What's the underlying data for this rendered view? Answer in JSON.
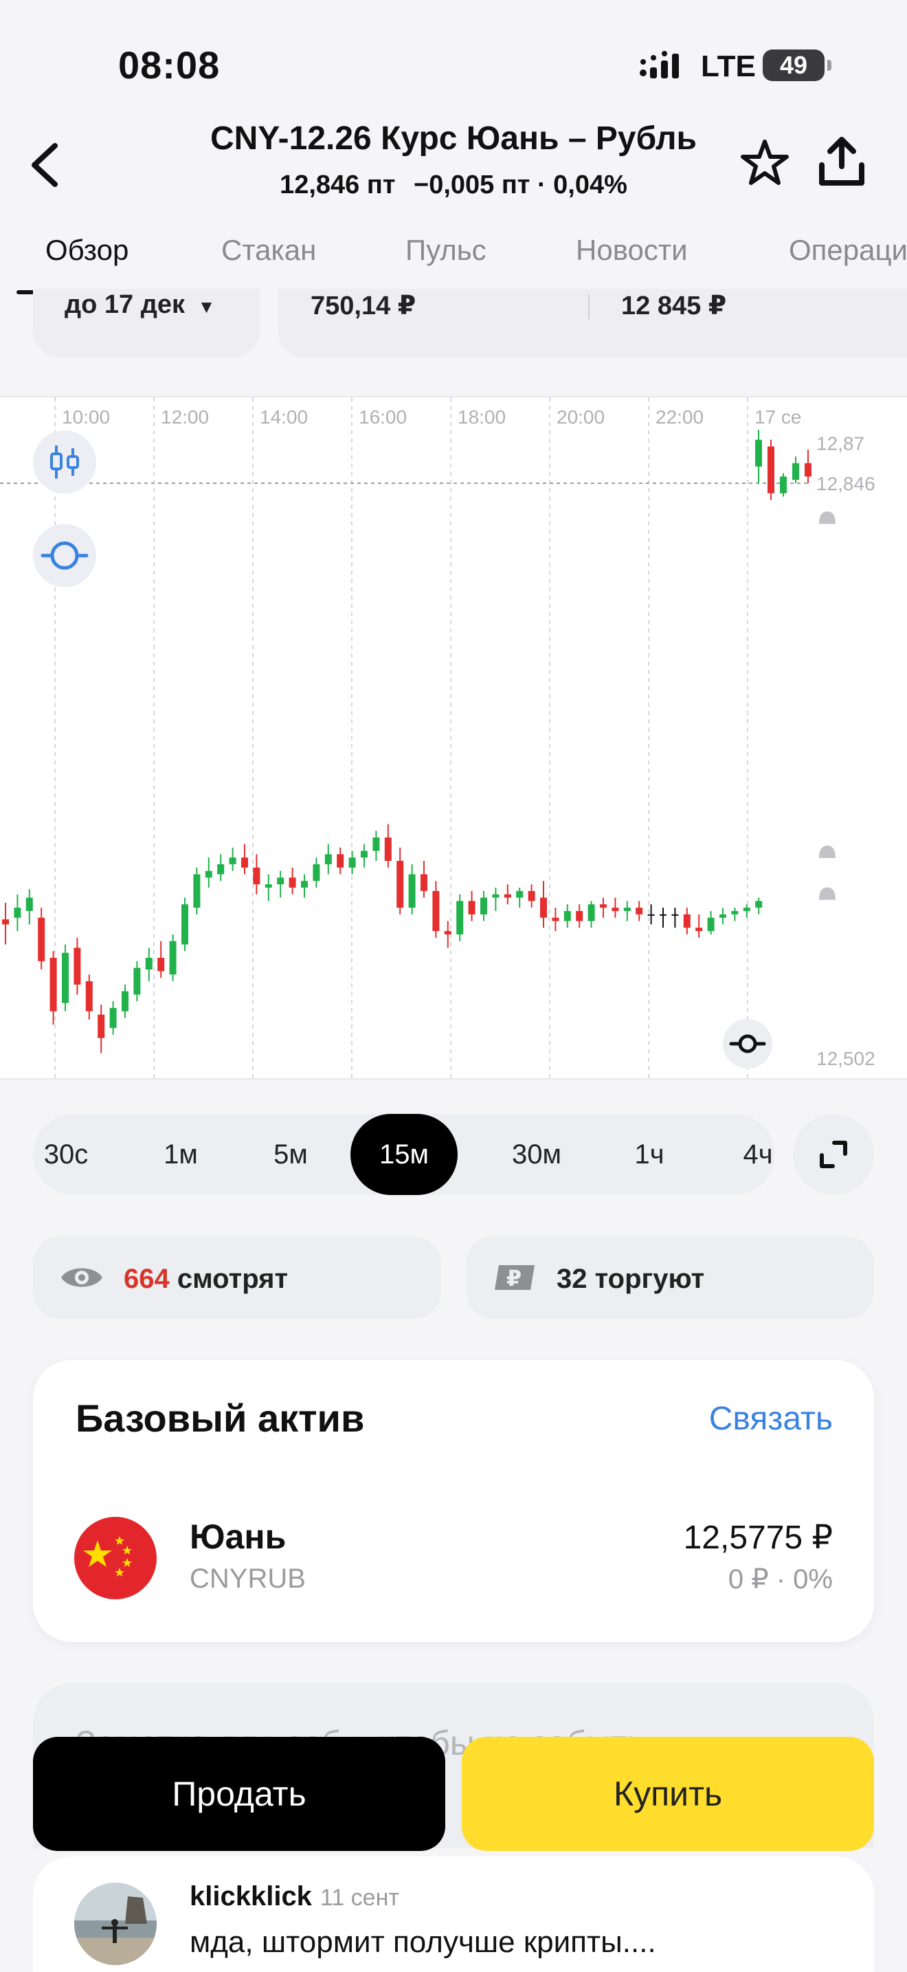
{
  "status_bar": {
    "time": "08:08",
    "network": "LTE",
    "battery": "49"
  },
  "header": {
    "title": "CNY-12.26 Курс Юань – Рубль",
    "price": "12,846 пт",
    "change": "−0,005 пт · 0,04%"
  },
  "tabs": [
    "Обзор",
    "Стакан",
    "Пульс",
    "Новости",
    "Операци"
  ],
  "summary": {
    "expiry": "до 17 дек",
    "value1": "750,14 ₽",
    "value2": "12 845 ₽"
  },
  "chart_data": {
    "type": "candlestick",
    "x_ticks": [
      "10:00",
      "12:00",
      "14:00",
      "16:00",
      "18:00",
      "20:00",
      "22:00",
      "17 се"
    ],
    "y_ticks": [
      "12,87",
      "12,846",
      "12,502"
    ],
    "current_price": "12,846",
    "ylim": [
      12.49,
      12.885
    ],
    "up_color": "#21b24b",
    "down_color": "#e52e2e",
    "series": [
      {
        "name": "",
        "values": [
          {
            "o": 12.585,
            "h": 12.595,
            "l": 12.57,
            "c": 12.582
          },
          {
            "o": 12.586,
            "h": 12.6,
            "l": 12.578,
            "c": 12.592
          },
          {
            "o": 12.59,
            "h": 12.603,
            "l": 12.582,
            "c": 12.598
          },
          {
            "o": 12.586,
            "h": 12.592,
            "l": 12.555,
            "c": 12.56
          },
          {
            "o": 12.562,
            "h": 12.566,
            "l": 12.522,
            "c": 12.53
          },
          {
            "o": 12.535,
            "h": 12.57,
            "l": 12.53,
            "c": 12.565
          },
          {
            "o": 12.568,
            "h": 12.574,
            "l": 12.54,
            "c": 12.546
          },
          {
            "o": 12.548,
            "h": 12.552,
            "l": 12.525,
            "c": 12.53
          },
          {
            "o": 12.528,
            "h": 12.534,
            "l": 12.505,
            "c": 12.514
          },
          {
            "o": 12.52,
            "h": 12.536,
            "l": 12.516,
            "c": 12.532
          },
          {
            "o": 12.53,
            "h": 12.546,
            "l": 12.526,
            "c": 12.542
          },
          {
            "o": 12.54,
            "h": 12.56,
            "l": 12.536,
            "c": 12.556
          },
          {
            "o": 12.555,
            "h": 12.568,
            "l": 12.548,
            "c": 12.562
          },
          {
            "o": 12.562,
            "h": 12.572,
            "l": 12.55,
            "c": 12.554
          },
          {
            "o": 12.552,
            "h": 12.576,
            "l": 12.548,
            "c": 12.572
          },
          {
            "o": 12.57,
            "h": 12.598,
            "l": 12.566,
            "c": 12.594
          },
          {
            "o": 12.592,
            "h": 12.616,
            "l": 12.588,
            "c": 12.612
          },
          {
            "o": 12.61,
            "h": 12.622,
            "l": 12.604,
            "c": 12.614
          },
          {
            "o": 12.612,
            "h": 12.624,
            "l": 12.608,
            "c": 12.618
          },
          {
            "o": 12.618,
            "h": 12.628,
            "l": 12.614,
            "c": 12.622
          },
          {
            "o": 12.622,
            "h": 12.63,
            "l": 12.612,
            "c": 12.616
          },
          {
            "o": 12.616,
            "h": 12.624,
            "l": 12.6,
            "c": 12.606
          },
          {
            "o": 12.604,
            "h": 12.612,
            "l": 12.596,
            "c": 12.606
          },
          {
            "o": 12.606,
            "h": 12.614,
            "l": 12.598,
            "c": 12.61
          },
          {
            "o": 12.61,
            "h": 12.616,
            "l": 12.6,
            "c": 12.604
          },
          {
            "o": 12.604,
            "h": 12.612,
            "l": 12.598,
            "c": 12.608
          },
          {
            "o": 12.608,
            "h": 12.622,
            "l": 12.604,
            "c": 12.618
          },
          {
            "o": 12.618,
            "h": 12.63,
            "l": 12.612,
            "c": 12.624
          },
          {
            "o": 12.624,
            "h": 12.628,
            "l": 12.612,
            "c": 12.616
          },
          {
            "o": 12.616,
            "h": 12.626,
            "l": 12.612,
            "c": 12.622
          },
          {
            "o": 12.622,
            "h": 12.63,
            "l": 12.616,
            "c": 12.626
          },
          {
            "o": 12.626,
            "h": 12.638,
            "l": 12.62,
            "c": 12.634
          },
          {
            "o": 12.634,
            "h": 12.642,
            "l": 12.616,
            "c": 12.62
          },
          {
            "o": 12.62,
            "h": 12.628,
            "l": 12.588,
            "c": 12.592
          },
          {
            "o": 12.592,
            "h": 12.618,
            "l": 12.588,
            "c": 12.612
          },
          {
            "o": 12.612,
            "h": 12.62,
            "l": 12.598,
            "c": 12.602
          },
          {
            "o": 12.602,
            "h": 12.608,
            "l": 12.574,
            "c": 12.578
          },
          {
            "o": 12.578,
            "h": 12.584,
            "l": 12.568,
            "c": 12.576
          },
          {
            "o": 12.576,
            "h": 12.6,
            "l": 12.572,
            "c": 12.596
          },
          {
            "o": 12.596,
            "h": 12.602,
            "l": 12.584,
            "c": 12.588
          },
          {
            "o": 12.588,
            "h": 12.602,
            "l": 12.584,
            "c": 12.598
          },
          {
            "o": 12.598,
            "h": 12.604,
            "l": 12.59,
            "c": 12.6
          },
          {
            "o": 12.6,
            "h": 12.606,
            "l": 12.594,
            "c": 12.598
          },
          {
            "o": 12.598,
            "h": 12.604,
            "l": 12.592,
            "c": 12.602
          },
          {
            "o": 12.602,
            "h": 12.606,
            "l": 12.592,
            "c": 12.596
          },
          {
            "o": 12.598,
            "h": 12.608,
            "l": 12.58,
            "c": 12.586
          },
          {
            "o": 12.586,
            "h": 12.592,
            "l": 12.578,
            "c": 12.584
          },
          {
            "o": 12.584,
            "h": 12.594,
            "l": 12.58,
            "c": 12.59
          },
          {
            "o": 12.59,
            "h": 12.594,
            "l": 12.58,
            "c": 12.584
          },
          {
            "o": 12.584,
            "h": 12.596,
            "l": 12.58,
            "c": 12.594
          },
          {
            "o": 12.594,
            "h": 12.598,
            "l": 12.586,
            "c": 12.592
          },
          {
            "o": 12.592,
            "h": 12.598,
            "l": 12.586,
            "c": 12.59
          },
          {
            "o": 12.59,
            "h": 12.596,
            "l": 12.584,
            "c": 12.592
          },
          {
            "o": 12.592,
            "h": 12.596,
            "l": 12.584,
            "c": 12.588
          },
          {
            "o": 12.588,
            "h": 12.594,
            "l": 12.582,
            "c": 12.588
          },
          {
            "o": 12.588,
            "h": 12.592,
            "l": 12.58,
            "c": 12.588
          },
          {
            "o": 12.588,
            "h": 12.592,
            "l": 12.58,
            "c": 12.588
          },
          {
            "o": 12.588,
            "h": 12.592,
            "l": 12.576,
            "c": 12.58
          },
          {
            "o": 12.58,
            "h": 12.588,
            "l": 12.574,
            "c": 12.578
          },
          {
            "o": 12.578,
            "h": 12.59,
            "l": 12.576,
            "c": 12.586
          },
          {
            "o": 12.586,
            "h": 12.592,
            "l": 12.582,
            "c": 12.588
          },
          {
            "o": 12.588,
            "h": 12.592,
            "l": 12.584,
            "c": 12.59
          },
          {
            "o": 12.59,
            "h": 12.594,
            "l": 12.586,
            "c": 12.592
          },
          {
            "o": 12.592,
            "h": 12.598,
            "l": 12.588,
            "c": 12.596
          },
          {
            "o": 12.856,
            "h": 12.878,
            "l": 12.846,
            "c": 12.872
          },
          {
            "o": 12.868,
            "h": 12.872,
            "l": 12.836,
            "c": 12.84
          },
          {
            "o": 12.84,
            "h": 12.852,
            "l": 12.838,
            "c": 12.85
          },
          {
            "o": 12.848,
            "h": 12.862,
            "l": 12.846,
            "c": 12.858
          },
          {
            "o": 12.858,
            "h": 12.866,
            "l": 12.846,
            "c": 12.85
          }
        ]
      }
    ]
  },
  "intervals": [
    "30с",
    "1м",
    "5м",
    "15м",
    "30м",
    "1ч",
    "4ч"
  ],
  "active_interval": "15м",
  "stats": {
    "watchers_count": "664",
    "watchers_label": "смотрят",
    "traders": "32 торгуют"
  },
  "base_asset": {
    "title": "Базовый актив",
    "link": "Связать",
    "name": "Юань",
    "ticker": "CNYRUB",
    "price": "12,5775 ₽",
    "change": "0 ₽ · 0%"
  },
  "note_placeholder": "Заметка для себя, чтобы не забыть",
  "actions": {
    "sell": "Продать",
    "buy": "Купить"
  },
  "comment": {
    "author": "klickklick",
    "date": "11 сент",
    "text": "мда, штормит получше крипты...."
  }
}
